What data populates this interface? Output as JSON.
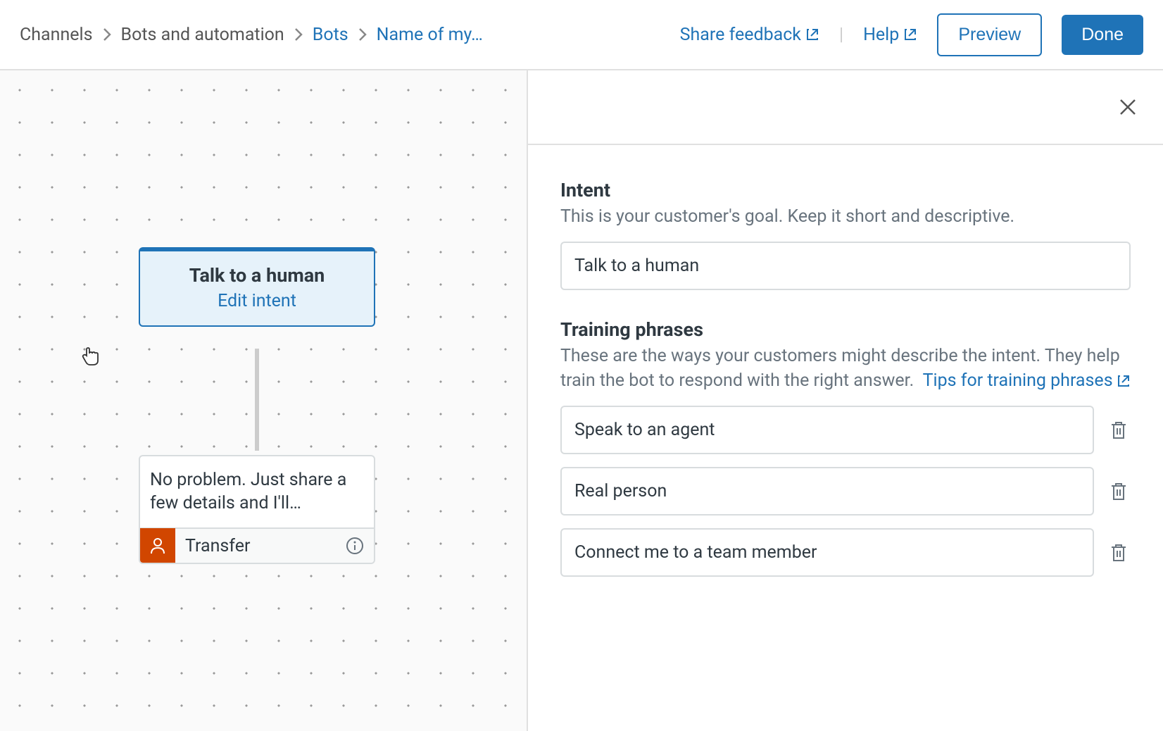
{
  "header": {
    "breadcrumb": {
      "items": [
        {
          "label": "Channels",
          "link": false
        },
        {
          "label": "Bots and automation",
          "link": false
        },
        {
          "label": "Bots",
          "link": true
        },
        {
          "label": "Name of my…",
          "link": true
        }
      ]
    },
    "share_feedback": "Share feedback",
    "help": "Help",
    "preview": "Preview",
    "done": "Done",
    "divider": "|"
  },
  "canvas": {
    "intent_node": {
      "title": "Talk to a human",
      "link": "Edit intent"
    },
    "response_node": {
      "text": "No problem. Just share a few details and I'll…",
      "transfer_label": "Transfer"
    }
  },
  "panel": {
    "intent": {
      "title": "Intent",
      "desc": "This is your customer's goal. Keep it short and descriptive.",
      "value": "Talk to a human"
    },
    "training": {
      "title": "Training phrases",
      "desc": "These are the ways your customers might describe the intent. They help train the bot to respond with the right answer.",
      "tips_link": "Tips for training phrases",
      "phrases": [
        "Speak to an agent",
        "Real person",
        "Connect me to a team member"
      ]
    }
  }
}
